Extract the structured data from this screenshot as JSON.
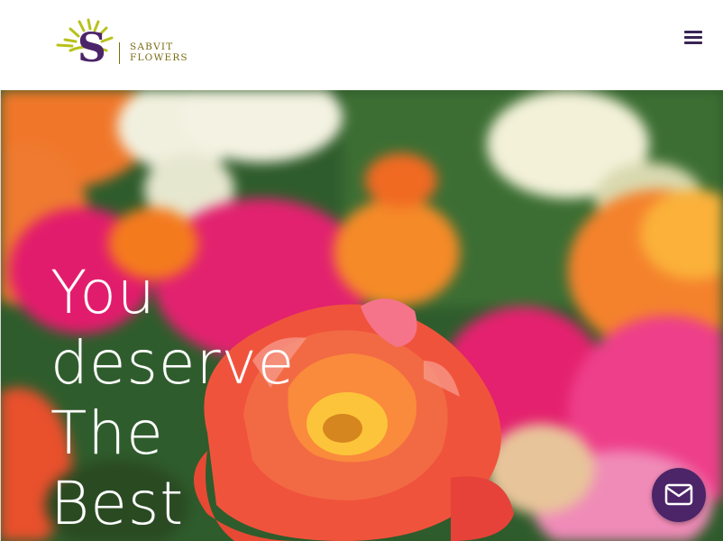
{
  "header": {
    "brand_line1": "SABVIT",
    "brand_line2": "FLOWERS",
    "brand_letter": "S",
    "menu_icon": "hamburger-menu-icon"
  },
  "hero": {
    "headline_lines": [
      "You",
      "deserve",
      "The",
      "Best"
    ]
  },
  "contact": {
    "icon": "envelope-icon"
  },
  "colors": {
    "brand_purple": "#4c2468",
    "brand_gold": "#7a6a12",
    "sun_green": "#b7c21a"
  }
}
